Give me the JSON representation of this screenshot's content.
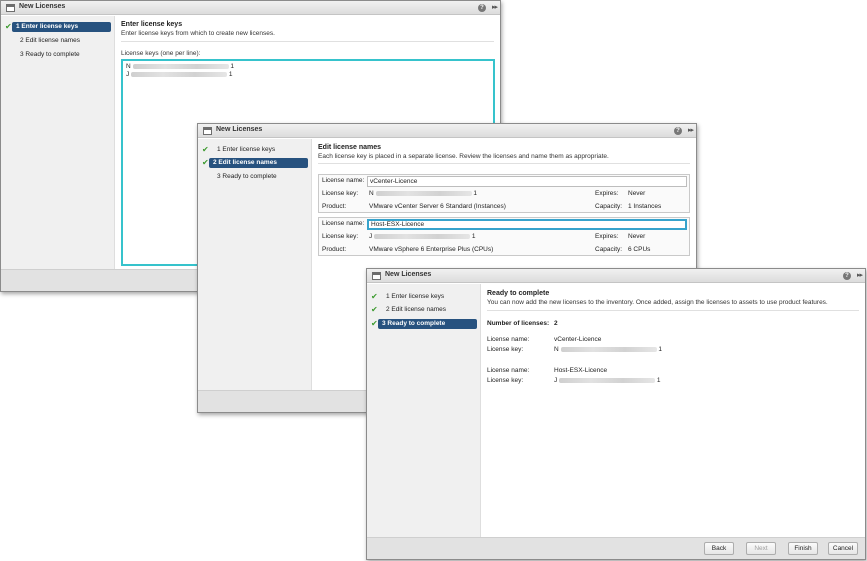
{
  "steps": {
    "s1": "1  Enter license keys",
    "s2": "2  Edit license names",
    "s3": "3  Ready to complete"
  },
  "dialog1": {
    "title": "New Licenses",
    "heading": "Enter license keys",
    "description": "Enter license keys from which to create new licenses.",
    "keys_label": "License keys (one per line):",
    "key1_prefix": "N",
    "key1_suffix": "1",
    "key2_prefix": "J",
    "key2_suffix": "1"
  },
  "dialog2": {
    "title": "New Licenses",
    "heading": "Edit license names",
    "description": "Each license key is placed in a separate license. Review the licenses and name them as appropriate.",
    "licenses": [
      {
        "name_label": "License name:",
        "name_value": "vCenter-Licence",
        "key_label": "License key:",
        "key_prefix": "N",
        "key_suffix": "1",
        "product_label": "Product:",
        "product_value": "VMware vCenter Server 6 Standard (Instances)",
        "expires_label": "Expires:",
        "expires_value": "Never",
        "capacity_label": "Capacity:",
        "capacity_value": "1 Instances"
      },
      {
        "name_label": "License name:",
        "name_value": "Host-ESX-Licence",
        "key_label": "License key:",
        "key_prefix": "J",
        "key_suffix": "1",
        "product_label": "Product:",
        "product_value": "VMware vSphere 6 Enterprise Plus (CPUs)",
        "expires_label": "Expires:",
        "expires_value": "Never",
        "capacity_label": "Capacity:",
        "capacity_value": "6 CPUs"
      }
    ]
  },
  "dialog3": {
    "title": "New Licenses",
    "heading": "Ready to complete",
    "description": "You can now add the new licenses to the inventory. Once added, assign the licenses to assets to use product features.",
    "count_label": "Number of licenses:",
    "count_value": "2",
    "license1_name_label": "License name:",
    "license1_name_value": "vCenter-Licence",
    "license1_key_label": "License key:",
    "license1_key_prefix": "N",
    "license1_key_suffix": "1",
    "license2_name_label": "License name:",
    "license2_name_value": "Host-ESX-Licence",
    "license2_key_label": "License key:",
    "license2_key_prefix": "J",
    "license2_key_suffix": "1",
    "buttons": {
      "back": "Back",
      "next": "Next",
      "finish": "Finish",
      "cancel": "Cancel"
    }
  },
  "icons": {
    "check": "check-icon",
    "help": "help-icon",
    "expand": "expand-icon",
    "window": "window-icon"
  },
  "colors": {
    "active_step": "#27527f",
    "check": "#3d9b2f",
    "focus": "#36c3cc"
  }
}
